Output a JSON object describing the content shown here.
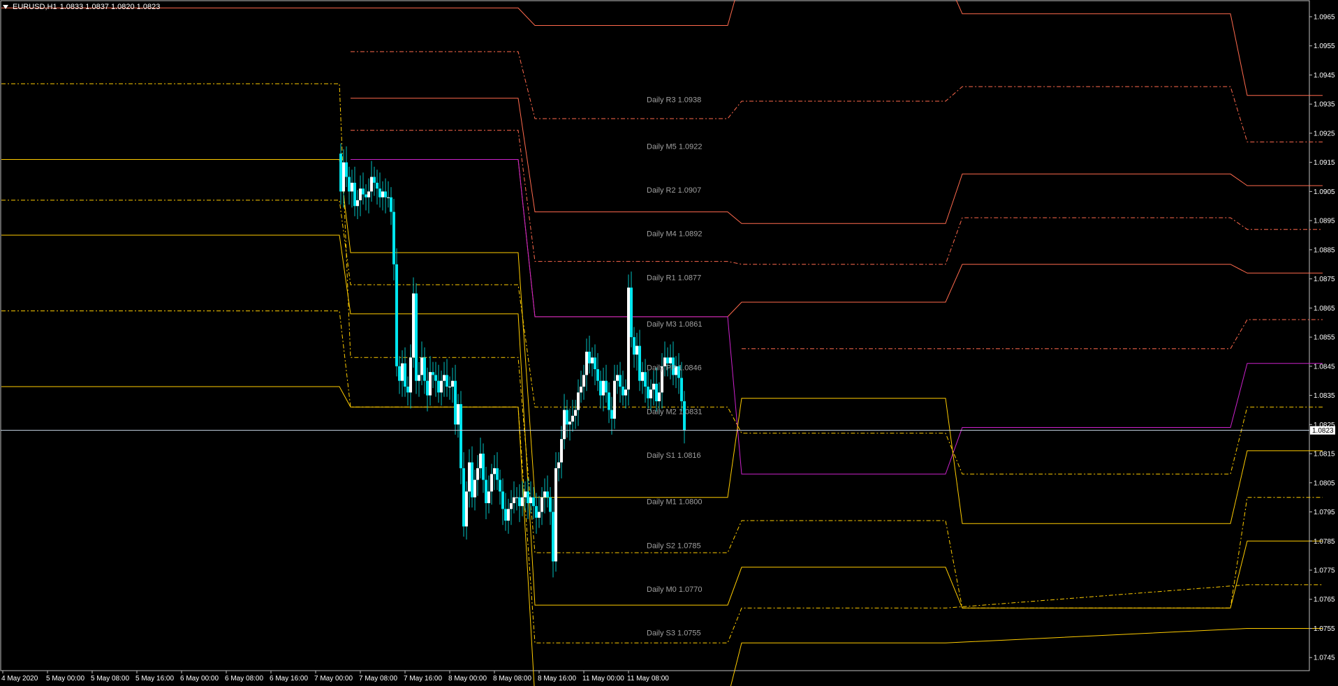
{
  "header": {
    "symbol_timeframe": "EURUSD,H1",
    "ohlc": "1.0833 1.0837 1.0820 1.0823"
  },
  "colors": {
    "background": "#000000",
    "axis": "#c0c0c0",
    "bull_candle": "#ffffff",
    "bear_candle": "#00e5ee",
    "wick": "#00c0c0",
    "resistance": "#ff6a4d",
    "resistance_mid": "#ff6a4d",
    "pivot": "#cc22cc",
    "support": "#ffcc00",
    "support_mid": "#ffcc00",
    "bid_line": "#c8d8e8",
    "label": "#a0a0a0"
  },
  "current_price": "1.0823",
  "chart_data": {
    "type": "candlestick",
    "title": "",
    "ylim": [
      1.07405,
      1.09705
    ],
    "y_ticks": [
      "1.0965",
      "1.0955",
      "1.0945",
      "1.0935",
      "1.0925",
      "1.0915",
      "1.0905",
      "1.0895",
      "1.0885",
      "1.0875",
      "1.0865",
      "1.0855",
      "1.0845",
      "1.0835",
      "1.0825",
      "1.0815",
      "1.0805",
      "1.0795",
      "1.0785",
      "1.0775",
      "1.0765",
      "1.0755",
      "1.0745"
    ],
    "x_ticks": [
      "4 May 2020",
      "5 May 00:00",
      "5 May 08:00",
      "5 May 16:00",
      "6 May 00:00",
      "6 May 08:00",
      "6 May 16:00",
      "7 May 00:00",
      "7 May 08:00",
      "7 May 16:00",
      "8 May 00:00",
      "8 May 08:00",
      "8 May 16:00",
      "11 May 00:00",
      "11 May 08:00"
    ],
    "candles": {
      "start_shift": 121,
      "open": [
        1.0918,
        1.0905,
        1.0915,
        1.091,
        1.0905,
        1.0908,
        1.09,
        1.0902,
        1.0906,
        1.0904,
        1.0903,
        1.0905,
        1.091,
        1.0908,
        1.0906,
        1.0903,
        1.0905,
        1.0903,
        1.0903,
        1.0898,
        1.088,
        1.0845,
        1.084,
        1.0846,
        1.0838,
        1.0836,
        1.0848,
        1.087,
        1.084,
        1.0842,
        1.0848,
        1.084,
        1.0835,
        1.0843,
        1.0842,
        1.084,
        1.0836,
        1.084,
        1.0842,
        1.0838,
        1.0838,
        1.084,
        1.0825,
        1.0832,
        1.081,
        1.079,
        1.0802,
        1.0812,
        1.08,
        1.0806,
        1.081,
        1.0815,
        1.0806,
        1.0798,
        1.0802,
        1.0808,
        1.081,
        1.0806,
        1.0802,
        1.0796,
        1.0792,
        1.0796,
        1.0798,
        1.08,
        1.08,
        1.0797,
        1.08,
        1.0802,
        1.0798,
        1.08,
        1.0797,
        1.0793,
        1.0795,
        1.08,
        1.0802,
        1.08,
        1.0795,
        1.0778,
        1.081,
        1.0812,
        1.082,
        1.083,
        1.0825,
        1.0826,
        1.0828,
        1.083,
        1.0836,
        1.0838,
        1.0842,
        1.085,
        1.0846,
        1.0848,
        1.0844,
        1.084,
        1.0835,
        1.084,
        1.0836,
        1.083,
        1.0827,
        1.084,
        1.0842,
        1.0838,
        1.0835,
        1.0837,
        1.0872,
        1.0855,
        1.0849,
        1.0852,
        1.084,
        1.0843,
        1.0838,
        1.0834,
        1.0837,
        1.0839,
        1.0833,
        1.0836,
        1.0845,
        1.0848,
        1.0846,
        1.0848,
        1.0842,
        1.0845,
        1.0841,
        1.0833
      ],
      "close": [
        1.0905,
        1.0915,
        1.091,
        1.0905,
        1.0908,
        1.09,
        1.0902,
        1.0906,
        1.0904,
        1.0903,
        1.0905,
        1.091,
        1.0908,
        1.0906,
        1.0903,
        1.0905,
        1.0903,
        1.0903,
        1.0898,
        1.088,
        1.0845,
        1.084,
        1.0846,
        1.0838,
        1.0836,
        1.0848,
        1.087,
        1.084,
        1.0842,
        1.0848,
        1.084,
        1.0835,
        1.0843,
        1.0842,
        1.084,
        1.0836,
        1.084,
        1.0842,
        1.0838,
        1.0838,
        1.084,
        1.0825,
        1.0832,
        1.081,
        1.079,
        1.0802,
        1.0812,
        1.08,
        1.0806,
        1.081,
        1.0815,
        1.0806,
        1.0798,
        1.0802,
        1.0808,
        1.081,
        1.0806,
        1.0802,
        1.0796,
        1.0792,
        1.0796,
        1.0798,
        1.08,
        1.08,
        1.0797,
        1.08,
        1.0802,
        1.0798,
        1.08,
        1.0797,
        1.0793,
        1.0795,
        1.08,
        1.0802,
        1.08,
        1.0795,
        1.0778,
        1.081,
        1.0812,
        1.082,
        1.083,
        1.0825,
        1.0826,
        1.0828,
        1.083,
        1.0836,
        1.0838,
        1.0842,
        1.085,
        1.0846,
        1.0848,
        1.0844,
        1.084,
        1.0835,
        1.084,
        1.0836,
        1.083,
        1.0827,
        1.084,
        1.0842,
        1.0838,
        1.0835,
        1.0837,
        1.0872,
        1.0855,
        1.0849,
        1.0852,
        1.084,
        1.0843,
        1.0838,
        1.0834,
        1.0837,
        1.0839,
        1.0833,
        1.0836,
        1.0845,
        1.0848,
        1.0846,
        1.0848,
        1.0842,
        1.0845,
        1.0841,
        1.0833,
        1.0823
      ]
    },
    "pivot_lines": [
      {
        "name": "R3",
        "kind": "resistance",
        "style": "solid",
        "label": "Daily R3 1.0938",
        "days": [
          [
            0,
            121,
            1.0968
          ],
          [
            125,
            185,
            1.0968
          ],
          [
            191,
            260,
            1.0962
          ],
          [
            265,
            338,
            1.0979
          ],
          [
            344,
            440,
            1.0966
          ],
          [
            446,
            473,
            1.0938
          ]
        ]
      },
      {
        "name": "M5",
        "kind": "resistance_mid",
        "style": "dashdot",
        "label": "Daily M5 1.0922",
        "days": [
          [
            125,
            185,
            1.0953
          ],
          [
            191,
            260,
            1.093
          ],
          [
            265,
            338,
            1.0936
          ],
          [
            344,
            440,
            1.0941
          ],
          [
            446,
            473,
            1.0922
          ]
        ]
      },
      {
        "name": "R2",
        "kind": "resistance",
        "style": "solid",
        "label": "Daily R2 1.0907",
        "days": [
          [
            125,
            185,
            1.0937
          ],
          [
            191,
            260,
            1.0898
          ],
          [
            265,
            338,
            1.0894
          ],
          [
            344,
            440,
            1.0911
          ],
          [
            446,
            473,
            1.0907
          ]
        ]
      },
      {
        "name": "M4",
        "kind": "resistance_mid",
        "style": "dashdot",
        "label": "Daily M4 1.0892",
        "days": [
          [
            125,
            185,
            1.0926
          ],
          [
            191,
            260,
            1.0881
          ],
          [
            265,
            338,
            1.088
          ],
          [
            344,
            440,
            1.0896
          ],
          [
            446,
            473,
            1.0892
          ]
        ]
      },
      {
        "name": "R1",
        "kind": "resistance",
        "style": "solid",
        "label": "Daily R1 1.0877",
        "days": [
          [
            125,
            185,
            1.0916
          ],
          [
            191,
            260,
            1.0862
          ],
          [
            265,
            338,
            1.0867
          ],
          [
            344,
            440,
            1.088
          ],
          [
            446,
            473,
            1.0877
          ]
        ]
      },
      {
        "name": "M3",
        "kind": "resistance_mid",
        "style": "dashdot",
        "label": "Daily M3 1.0861",
        "days": [
          [
            265,
            338,
            1.0851
          ],
          [
            344,
            440,
            1.0851
          ],
          [
            446,
            473,
            1.0861
          ]
        ]
      },
      {
        "name": "PP",
        "kind": "pivot",
        "style": "solid",
        "label": "Daily PP 1.0846",
        "days": [
          [
            125,
            185,
            1.0916
          ],
          [
            191,
            260,
            1.0862
          ],
          [
            265,
            338,
            1.0808
          ],
          [
            344,
            440,
            1.0824
          ],
          [
            446,
            473,
            1.0846
          ]
        ]
      },
      {
        "name": "S1",
        "kind": "support",
        "style": "solid",
        "label": "Daily S1 1.0816",
        "days": [
          [
            0,
            121,
            1.0916
          ],
          [
            125,
            185,
            1.0884
          ],
          [
            191,
            260,
            1.08
          ],
          [
            265,
            338,
            1.0834
          ],
          [
            344,
            440,
            1.0791
          ],
          [
            446,
            473,
            1.0816
          ]
        ]
      },
      {
        "name": "M2",
        "kind": "support_mid",
        "style": "dashdot",
        "label": "Daily M2 1.0831",
        "days": [
          [
            0,
            121,
            1.0902
          ],
          [
            125,
            185,
            1.0873
          ],
          [
            191,
            260,
            1.0831
          ],
          [
            265,
            338,
            1.0822
          ],
          [
            344,
            440,
            1.0808
          ],
          [
            446,
            473,
            1.0831
          ]
        ]
      },
      {
        "name": "M1",
        "kind": "support_mid",
        "style": "dashdot",
        "label": "Daily M1 1.0800",
        "days": [
          [
            0,
            121,
            1.0942
          ],
          [
            125,
            185,
            1.0848
          ],
          [
            191,
            260,
            1.0781
          ],
          [
            265,
            338,
            1.0792
          ],
          [
            344,
            440,
            1.0762
          ],
          [
            446,
            473,
            1.08
          ]
        ]
      },
      {
        "name": "S2",
        "kind": "support",
        "style": "solid",
        "label": "Daily S2 1.0785",
        "days": [
          [
            0,
            121,
            1.089
          ],
          [
            125,
            185,
            1.0863
          ],
          [
            191,
            260,
            1.0763
          ],
          [
            265,
            338,
            1.0776
          ],
          [
            344,
            440,
            1.0762
          ],
          [
            446,
            473,
            1.0785
          ]
        ]
      },
      {
        "name": "M0",
        "kind": "support_mid",
        "style": "dashdot",
        "label": "Daily M0 1.0770",
        "days": [
          [
            0,
            121,
            1.0864
          ],
          [
            125,
            185,
            1.0831
          ],
          [
            191,
            260,
            1.075
          ],
          [
            265,
            338,
            1.0762
          ],
          [
            446,
            473,
            1.077
          ]
        ]
      },
      {
        "name": "S3",
        "kind": "support",
        "style": "solid",
        "label": "Daily S3 1.0755",
        "days": [
          [
            0,
            121,
            1.0838
          ],
          [
            125,
            185,
            1.0831
          ],
          [
            191,
            260,
            1.0731
          ],
          [
            265,
            338,
            1.075
          ],
          [
            446,
            473,
            1.0755
          ]
        ]
      }
    ]
  }
}
